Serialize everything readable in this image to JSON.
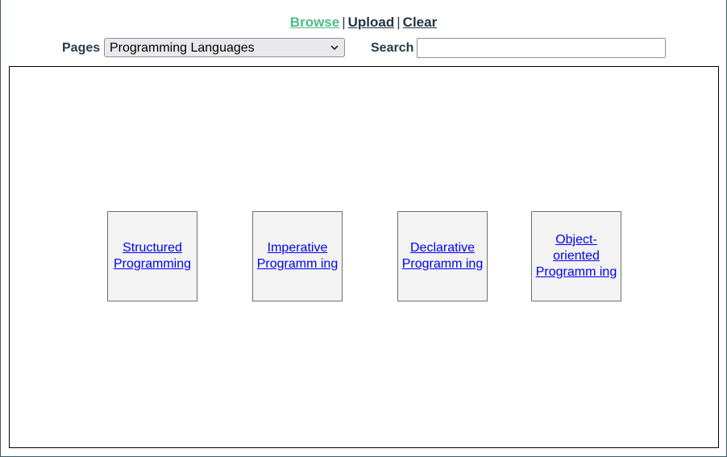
{
  "nav": {
    "browse": "Browse",
    "upload": "Upload",
    "clear": "Clear",
    "separator": "|",
    "active_color": "#4dbb85"
  },
  "controls": {
    "pages_label": "Pages",
    "pages_selected": "Programming Languages",
    "search_label": "Search",
    "search_value": ""
  },
  "nodes": [
    {
      "line1": "Structured",
      "line2": "Programming",
      "line3": ""
    },
    {
      "line1": "Imperative",
      "line2": "Programm ing",
      "line3": ""
    },
    {
      "line1": "Declarative",
      "line2": "Programm ing",
      "line3": ""
    },
    {
      "line1": "Object-",
      "line2": "oriented",
      "line3": "Programm ing"
    }
  ]
}
